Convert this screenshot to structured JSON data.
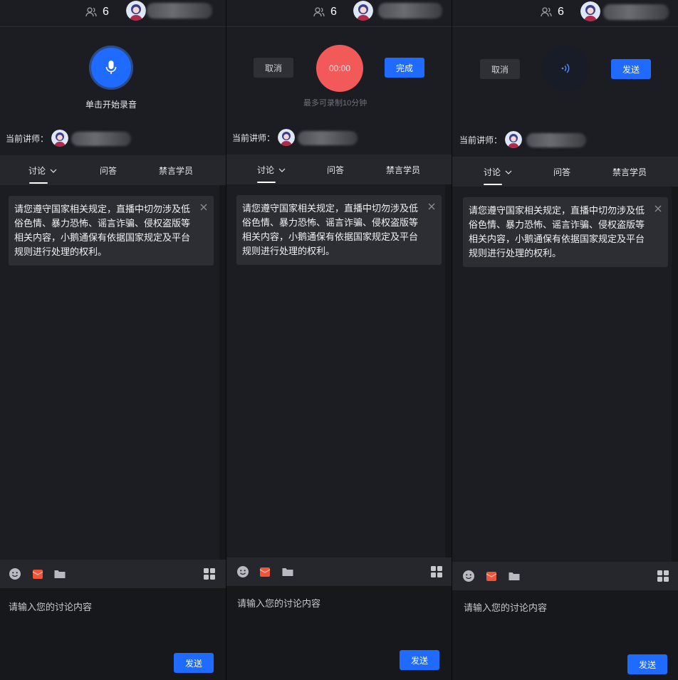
{
  "panels": [
    {
      "viewer_count": "6",
      "rec_hint": "单击开始录音",
      "lecturer_label": "当前讲师：",
      "tabs": [
        "讨论",
        "问答",
        "禁言学员"
      ],
      "notice": "请您遵守国家相关规定，直播中切勿涉及低俗色情、暴力恐怖、谣言诈骗、侵权盗版等相关内容，小鹅通保有依据国家规定及平台规则进行处理的权利。",
      "input_placeholder": "请输入您的讨论内容",
      "send_label": "发送"
    },
    {
      "viewer_count": "6",
      "cancel_label": "取消",
      "timer": "00:00",
      "done_label": "完成",
      "max_hint": "最多可录制10分钟",
      "lecturer_label": "当前讲师：",
      "tabs": [
        "讨论",
        "问答",
        "禁言学员"
      ],
      "notice": "请您遵守国家相关规定，直播中切勿涉及低俗色情、暴力恐怖、谣言诈骗、侵权盗版等相关内容，小鹅通保有依据国家规定及平台规则进行处理的权利。",
      "input_placeholder": "请输入您的讨论内容",
      "send_label": "发送"
    },
    {
      "viewer_count": "6",
      "cancel_label": "取消",
      "rec_send_label": "发送",
      "lecturer_label": "当前讲师：",
      "tabs": [
        "讨论",
        "问答",
        "禁言学员"
      ],
      "notice": "请您遵守国家相关规定，直播中切勿涉及低俗色情、暴力恐怖、谣言诈骗、侵权盗版等相关内容，小鹅通保有依据国家规定及平台规则进行处理的权利。",
      "input_placeholder": "请输入您的讨论内容",
      "send_label": "发送"
    }
  ],
  "icons": {
    "viewer": "users-icon",
    "mic": "microphone-icon",
    "wave": "audio-wave-icon",
    "close": "close-icon",
    "chevron": "chevron-down-icon",
    "emoji": "emoji-icon",
    "gift": "red-packet-icon",
    "folder": "folder-icon",
    "grid": "grid-icon"
  },
  "colors": {
    "primary": "#1f6bff",
    "recording": "#f25a5a",
    "panel_bg": "#1c1d22",
    "bar_bg": "#25272d"
  }
}
